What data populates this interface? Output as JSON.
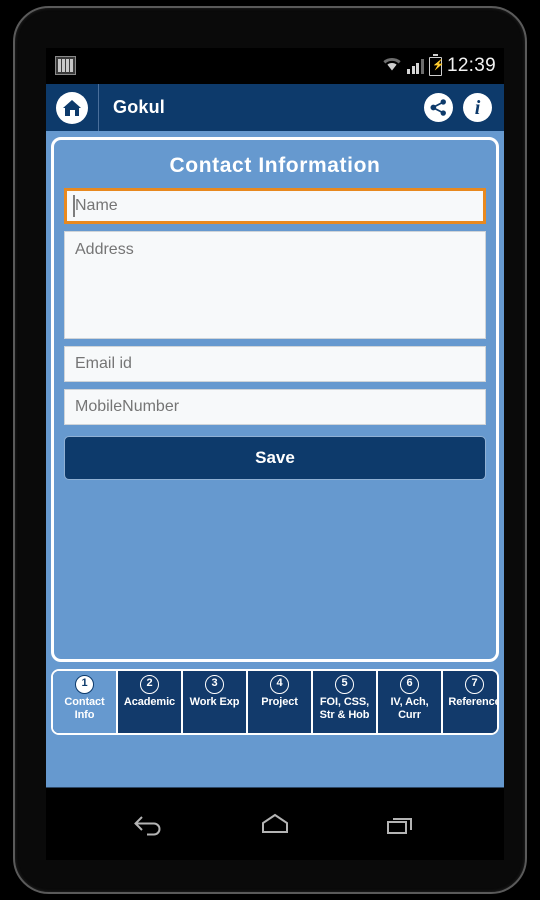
{
  "status_bar": {
    "time": "12:39",
    "icons": [
      "sim-card-icon",
      "wifi-icon",
      "cellular-signal-icon",
      "battery-charging-icon"
    ]
  },
  "app_bar": {
    "title": "Gokul",
    "home_icon": "home-icon",
    "share_icon": "share-icon",
    "info_icon": "info-icon",
    "background_color": "#0d3a6b"
  },
  "form": {
    "section_title": "Contact  Information",
    "fields": [
      {
        "name": "name",
        "placeholder": "Name",
        "value": "",
        "focused": true
      },
      {
        "name": "address",
        "placeholder": "Address",
        "value": "",
        "focused": false
      },
      {
        "name": "email",
        "placeholder": "Email id",
        "value": "",
        "focused": false
      },
      {
        "name": "mobile",
        "placeholder": "MobileNumber",
        "value": "",
        "focused": false
      }
    ],
    "save_label": "Save",
    "panel_color": "#6699cf",
    "focus_color": "#e8891f"
  },
  "tabs": [
    {
      "number": "1",
      "label": "Contact\nInfo",
      "active": true
    },
    {
      "number": "2",
      "label": "Academic",
      "active": false
    },
    {
      "number": "3",
      "label": "Work Exp",
      "active": false
    },
    {
      "number": "4",
      "label": "Project",
      "active": false
    },
    {
      "number": "5",
      "label": "FOI, CSS,\nStr & Hob",
      "active": false
    },
    {
      "number": "6",
      "label": "IV, Ach,\nCurr",
      "active": false
    },
    {
      "number": "7",
      "label": "Reference",
      "active": false
    }
  ],
  "nav_bar": {
    "back_icon": "back-arrow-icon",
    "home_icon": "home-pentagon-icon",
    "recents_icon": "recent-apps-icon"
  }
}
